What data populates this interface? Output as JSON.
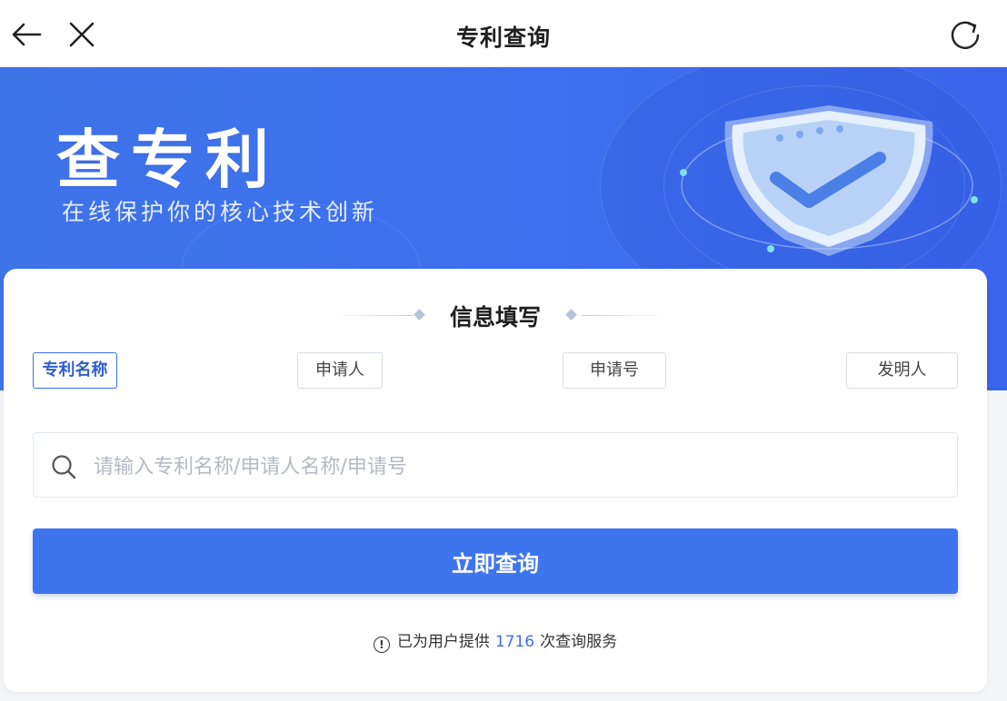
{
  "header": {
    "title": "专利查询",
    "icons": {
      "back": "arrow-left-icon",
      "close": "close-icon",
      "refresh": "refresh-icon"
    }
  },
  "banner": {
    "title": "查专利",
    "subtitle": "在线保护你的核心技术创新",
    "illustration": "shield-check-icon"
  },
  "form": {
    "section_title": "信息填写",
    "tabs": [
      {
        "label": "专利名称",
        "active": true
      },
      {
        "label": "申请人",
        "active": false
      },
      {
        "label": "申请号",
        "active": false
      },
      {
        "label": "发明人",
        "active": false
      }
    ],
    "search": {
      "placeholder": "请输入专利名称/申请人名称/申请号",
      "value": ""
    },
    "submit_label": "立即查询",
    "footer": {
      "prefix": "已为用户提供",
      "count": "1716",
      "suffix": "次查询服务"
    }
  },
  "colors": {
    "primary": "#3f74ef",
    "banner": "#3e6ff0",
    "active_tab_border": "#3d6fe5"
  }
}
